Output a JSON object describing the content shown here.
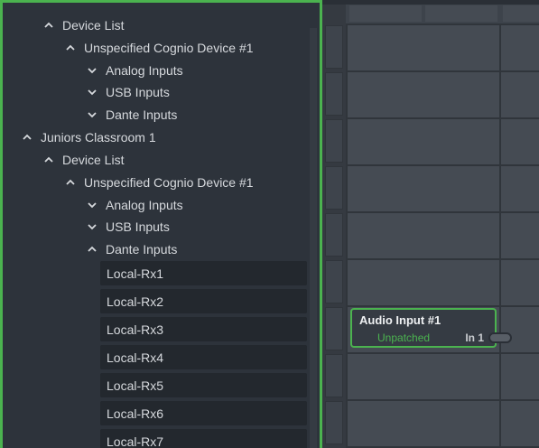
{
  "tree": {
    "rows": [
      {
        "label": "Device List",
        "chevron": "up"
      },
      {
        "label": "Unspecified Cognio Device #1",
        "chevron": "up"
      },
      {
        "label": "Analog Inputs",
        "chevron": "down"
      },
      {
        "label": "USB Inputs",
        "chevron": "down"
      },
      {
        "label": "Dante Inputs",
        "chevron": "down"
      },
      {
        "label": "Juniors Classroom 1",
        "chevron": "up"
      },
      {
        "label": "Device List",
        "chevron": "up"
      },
      {
        "label": "Unspecified Cognio Device #1",
        "chevron": "up"
      },
      {
        "label": "Analog Inputs",
        "chevron": "down"
      },
      {
        "label": "USB Inputs",
        "chevron": "down"
      },
      {
        "label": "Dante Inputs",
        "chevron": "up"
      }
    ],
    "leaves": [
      "Local-Rx1",
      "Local-Rx2",
      "Local-Rx3",
      "Local-Rx4",
      "Local-Rx5",
      "Local-Rx6",
      "Local-Rx7"
    ]
  },
  "node": {
    "title": "Audio Input #1",
    "status": "Unpatched",
    "port_label": "In 1"
  },
  "colors": {
    "accent": "#4bb34f",
    "panel_bg": "#2d333b",
    "leaf_bg": "#23282e",
    "grid_bg": "#454b53"
  }
}
